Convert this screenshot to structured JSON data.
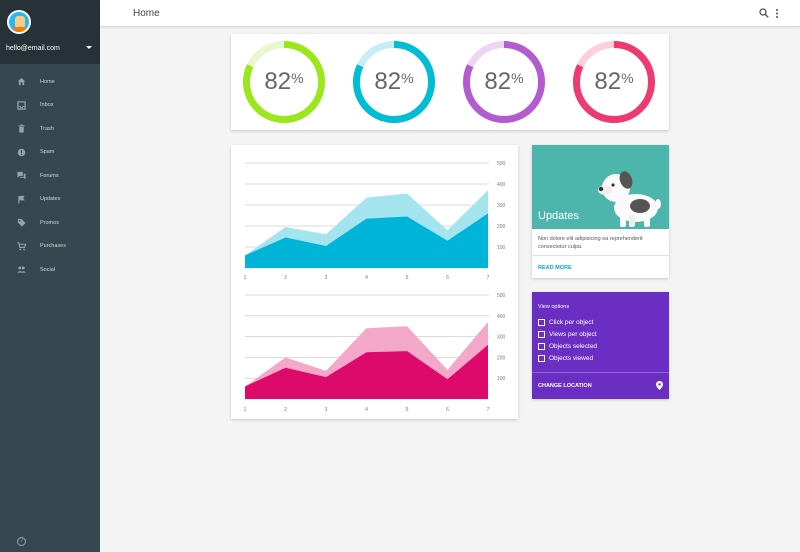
{
  "account": {
    "email": "hello@email.com"
  },
  "nav": {
    "items": [
      {
        "label": "Home",
        "icon": "home-icon"
      },
      {
        "label": "Inbox",
        "icon": "inbox-icon"
      },
      {
        "label": "Trash",
        "icon": "trash-icon"
      },
      {
        "label": "Spam",
        "icon": "spam-icon"
      },
      {
        "label": "Forums",
        "icon": "forums-icon"
      },
      {
        "label": "Updates",
        "icon": "flag-icon"
      },
      {
        "label": "Promos",
        "icon": "tag-icon"
      },
      {
        "label": "Purchases",
        "icon": "cart-icon"
      },
      {
        "label": "Social",
        "icon": "people-icon"
      }
    ],
    "help_glyph": "?"
  },
  "topbar": {
    "title": "Home",
    "search_icon": "search-icon",
    "more_icon": "more-vert-icon"
  },
  "stats": [
    {
      "value": "82",
      "unit": "%",
      "fraction": 0.82,
      "color": "#9ae81c",
      "track": "#e6f8cc"
    },
    {
      "value": "82",
      "unit": "%",
      "fraction": 0.82,
      "color": "#00bcd4",
      "track": "#c7eef4"
    },
    {
      "value": "82",
      "unit": "%",
      "fraction": 0.82,
      "color": "#b25cd0",
      "track": "#ecd6f4"
    },
    {
      "value": "82",
      "unit": "%",
      "fraction": 0.82,
      "color": "#ee3b6f",
      "track": "#fbd0dc"
    }
  ],
  "chart_data": [
    {
      "type": "area",
      "x": [
        1,
        2,
        3,
        4,
        5,
        6,
        7
      ],
      "ylim": [
        0,
        500
      ],
      "yticks": [
        100,
        200,
        300,
        400,
        500
      ],
      "grid": true,
      "series": [
        {
          "values": [
            60,
            195,
            160,
            335,
            355,
            180,
            370
          ],
          "color": "#a3e4ee"
        },
        {
          "values": [
            60,
            145,
            105,
            235,
            245,
            130,
            260
          ],
          "color": "#00b4d8"
        }
      ]
    },
    {
      "type": "area",
      "x": [
        1,
        2,
        3,
        4,
        5,
        6,
        7
      ],
      "ylim": [
        0,
        500
      ],
      "yticks": [
        100,
        200,
        300,
        400,
        500
      ],
      "grid": true,
      "series": [
        {
          "values": [
            60,
            200,
            135,
            340,
            350,
            140,
            370
          ],
          "color": "#f3a7c9"
        },
        {
          "values": [
            60,
            150,
            105,
            225,
            230,
            95,
            260
          ],
          "color": "#dd0a6c"
        }
      ]
    }
  ],
  "updates": {
    "title": "Updates",
    "text": "Non dolore elit adipisicing ea reprehenderit consectetur culpa.",
    "action": "READ MORE",
    "hero_color": "#4db6ac"
  },
  "view_options": {
    "title": "View options",
    "options": [
      "Click per object",
      "Views per object",
      "Objects selected",
      "Objects viewed"
    ],
    "action": "CHANGE LOCATION",
    "color": "#6a2fc2"
  }
}
